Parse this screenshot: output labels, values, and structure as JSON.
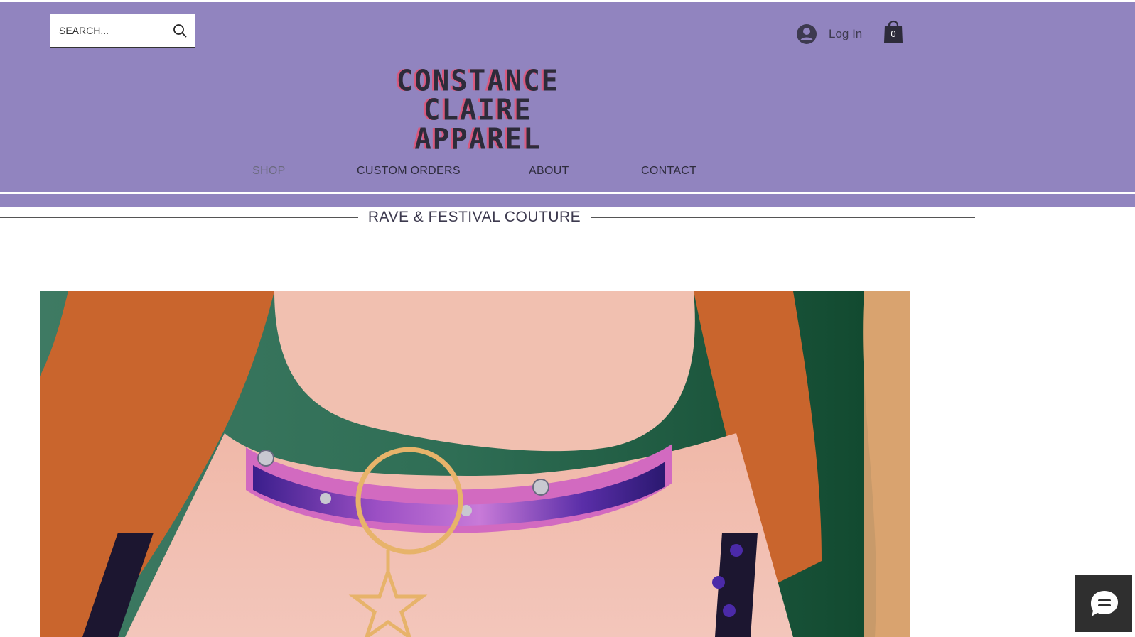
{
  "search": {
    "placeholder": "SEARCH..."
  },
  "account": {
    "login_label": "Log In"
  },
  "cart": {
    "count": "0"
  },
  "brand": {
    "line1": "CONSTANCE CLAIRE",
    "line2": "APPAREL"
  },
  "nav": {
    "items": [
      {
        "label": "SHOP",
        "active": true
      },
      {
        "label": "CUSTOM ORDERS",
        "active": false
      },
      {
        "label": "ABOUT",
        "active": false
      },
      {
        "label": "CONTACT",
        "active": false
      }
    ]
  },
  "tagline": "RAVE & FESTIVAL COUTURE",
  "colors": {
    "header_bg": "#9184bf",
    "text_dark": "#2e2c3d",
    "logo_shadow": "#d8597e",
    "chat_bg": "#2f2f2f"
  },
  "icons": {
    "search": "search-icon",
    "avatar": "user-avatar-icon",
    "cart": "shopping-bag-icon",
    "chat": "chat-bubble-icon"
  }
}
